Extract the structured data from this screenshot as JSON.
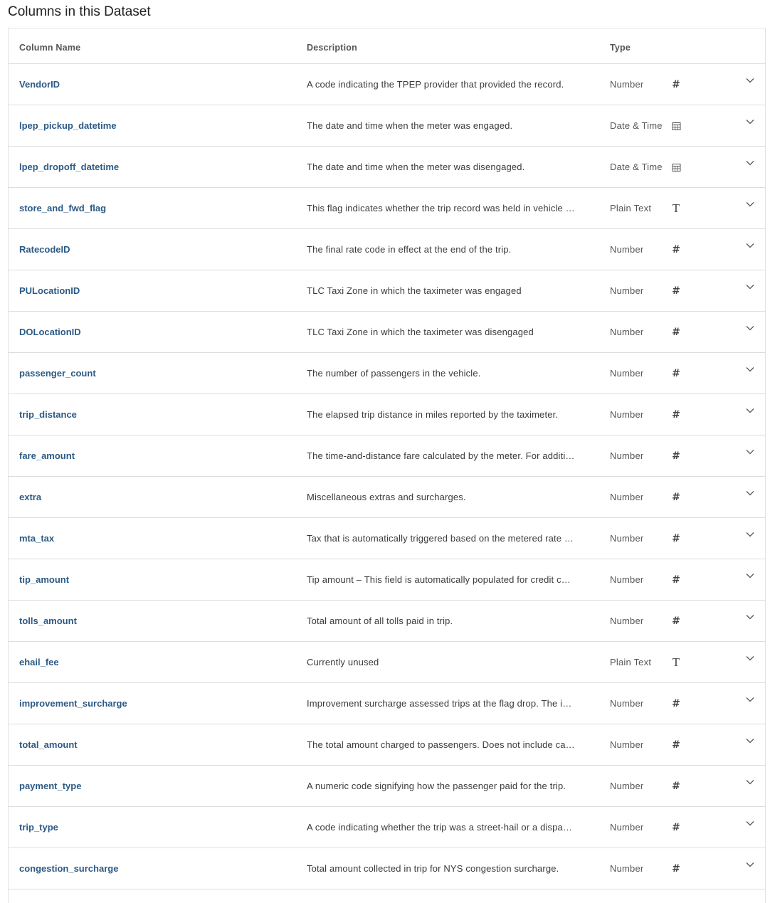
{
  "page": {
    "title": "Columns in this Dataset"
  },
  "table": {
    "headers": {
      "name": "Column Name",
      "description": "Description",
      "type": "Type"
    },
    "rows": [
      {
        "name": "VendorID",
        "description": "A code indicating the TPEP provider that provided the record.",
        "type": "Number",
        "icon": "hash-icon"
      },
      {
        "name": "lpep_pickup_datetime",
        "description": "The date and time when the meter was engaged.",
        "type": "Date & Time",
        "icon": "calendar-icon"
      },
      {
        "name": "lpep_dropoff_datetime",
        "description": "The date and time when the meter was disengaged.",
        "type": "Date & Time",
        "icon": "calendar-icon"
      },
      {
        "name": "store_and_fwd_flag",
        "description": "This flag indicates whether the trip record was held in vehicle …",
        "type": "Plain Text",
        "icon": "text-icon"
      },
      {
        "name": "RatecodeID",
        "description": "The final rate code in effect at the end of the trip.",
        "type": "Number",
        "icon": "hash-icon"
      },
      {
        "name": "PULocationID",
        "description": "TLC Taxi Zone in which the taximeter was engaged",
        "type": "Number",
        "icon": "hash-icon"
      },
      {
        "name": "DOLocationID",
        "description": "TLC Taxi Zone in which the taximeter was disengaged",
        "type": "Number",
        "icon": "hash-icon"
      },
      {
        "name": "passenger_count",
        "description": "The number of passengers in the vehicle.",
        "type": "Number",
        "icon": "hash-icon"
      },
      {
        "name": "trip_distance",
        "description": "The elapsed trip distance in miles reported by the taximeter.",
        "type": "Number",
        "icon": "hash-icon"
      },
      {
        "name": "fare_amount",
        "description": "The time-and-distance fare calculated by the meter. For additi…",
        "type": "Number",
        "icon": "hash-icon"
      },
      {
        "name": "extra",
        "description": "Miscellaneous extras and surcharges.",
        "type": "Number",
        "icon": "hash-icon"
      },
      {
        "name": "mta_tax",
        "description": "Tax that is automatically triggered based on the metered rate …",
        "type": "Number",
        "icon": "hash-icon"
      },
      {
        "name": "tip_amount",
        "description": "Tip amount – This field is automatically populated for credit c…",
        "type": "Number",
        "icon": "hash-icon"
      },
      {
        "name": "tolls_amount",
        "description": "Total amount of all tolls paid in trip.",
        "type": "Number",
        "icon": "hash-icon"
      },
      {
        "name": "ehail_fee",
        "description": "Currently unused",
        "type": "Plain Text",
        "icon": "text-icon"
      },
      {
        "name": "improvement_surcharge",
        "description": "Improvement surcharge assessed trips at the flag drop. The i…",
        "type": "Number",
        "icon": "hash-icon"
      },
      {
        "name": "total_amount",
        "description": "The total amount charged to passengers. Does not include ca…",
        "type": "Number",
        "icon": "hash-icon"
      },
      {
        "name": "payment_type",
        "description": "A numeric code signifying how the passenger paid for the trip.",
        "type": "Number",
        "icon": "hash-icon"
      },
      {
        "name": "trip_type",
        "description": "A code indicating whether the trip was a street-hail or a dispa…",
        "type": "Number",
        "icon": "hash-icon"
      },
      {
        "name": "congestion_surcharge",
        "description": "Total amount collected in trip for NYS congestion surcharge.",
        "type": "Number",
        "icon": "hash-icon"
      }
    ]
  },
  "colors": {
    "column_name": "#2c5a85",
    "border": "#dddddd"
  }
}
